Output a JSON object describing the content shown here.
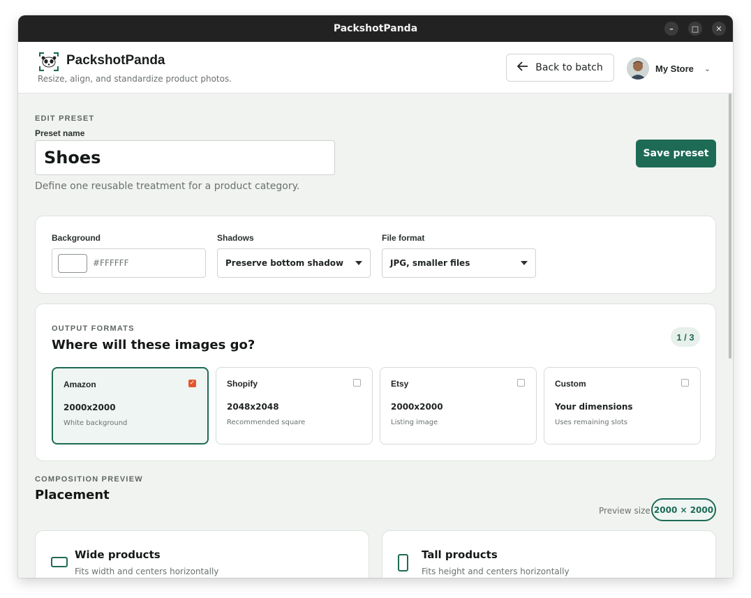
{
  "window": {
    "title": "PackshotPanda",
    "controls": {
      "minimize": "–",
      "maximize": "□",
      "close": "✕"
    }
  },
  "header": {
    "brand_name": "PackshotPanda",
    "tagline": "Resize, align, and standardize product photos.",
    "back_label": "Back to batch",
    "store_name": "My Store"
  },
  "edit": {
    "eyebrow": "EDIT PRESET",
    "name_label": "Preset name",
    "name_value": "Shoes",
    "description": "Define one reusable treatment for a product category.",
    "save_label": "Save preset"
  },
  "settings": {
    "background_label": "Background",
    "background_value": "#FFFFFF",
    "shadows_label": "Shadows",
    "shadows_value": "Preserve bottom shadow",
    "format_label": "File format",
    "format_value": "JPG, smaller files"
  },
  "outputs": {
    "eyebrow": "OUTPUT FORMATS",
    "title": "Where will these images go?",
    "count": "1 / 3",
    "items": [
      {
        "name": "Amazon",
        "dims": "2000x2000",
        "note": "White background",
        "checked": true
      },
      {
        "name": "Shopify",
        "dims": "2048x2048",
        "note": "Recommended square",
        "checked": false
      },
      {
        "name": "Etsy",
        "dims": "2000x2000",
        "note": "Listing image",
        "checked": false
      },
      {
        "name": "Custom",
        "dims": "Your dimensions",
        "note": "Uses remaining slots",
        "checked": false
      }
    ]
  },
  "composition": {
    "eyebrow": "COMPOSITION PREVIEW",
    "title": "Placement",
    "preview_label": "Preview size",
    "preview_value": "2000 × 2000",
    "cards": [
      {
        "title": "Wide products",
        "desc": "Fits width and centers horizontally"
      },
      {
        "title": "Tall products",
        "desc": "Fits height and centers horizontally"
      }
    ]
  },
  "colors": {
    "accent": "#1d6a55",
    "checkbox_on": "#e4572e",
    "titlebar": "#222222",
    "page_bg": "#f1f3f0"
  }
}
